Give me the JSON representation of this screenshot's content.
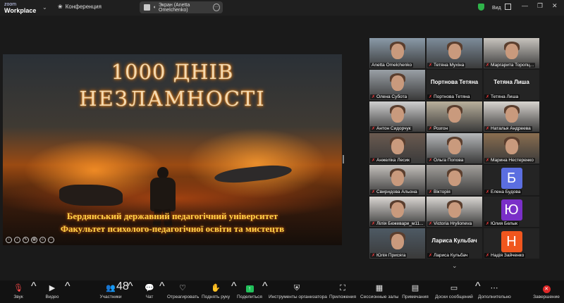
{
  "app": {
    "logo_line1": "zoom",
    "logo_line2": "Workplace"
  },
  "meeting": {
    "title": "Конференция"
  },
  "screen_share_pill": {
    "label": "Экран (Anetta Omelchenko)"
  },
  "top_right": {
    "view_label": "Вид"
  },
  "slide": {
    "title_line1": "1000 ДНІВ",
    "title_line2": "НЕЗЛАМНОСТІ",
    "bottom_line1": "Бердянський державний педагогічний університет",
    "bottom_line2": "Факультет психолого-педагогічної освіти та мистецтв"
  },
  "participants": [
    {
      "name": "Anetta Omelchenko",
      "muted": false,
      "speaking": true,
      "type": "video",
      "bg": "#8a9aa8"
    },
    {
      "name": "Тетяна Мухіна",
      "muted": true,
      "type": "video",
      "bg": "#7d8c9a"
    },
    {
      "name": "Маргарита Торопц...",
      "muted": true,
      "type": "video",
      "bg": "#c8c4be"
    },
    {
      "name": "Олена Субота",
      "muted": true,
      "type": "video",
      "bg": "#9aa0a6"
    },
    {
      "name": "Портнова Тетяна",
      "display": "Портнова Тетяна",
      "muted": true,
      "type": "name"
    },
    {
      "name": "Тетяна Лиша",
      "display": "Тетяна Лиша",
      "muted": true,
      "type": "name"
    },
    {
      "name": "Антон Сидорчук",
      "muted": true,
      "type": "video",
      "bg": "#cfcfcf"
    },
    {
      "name": "Розгон",
      "muted": true,
      "type": "video",
      "bg": "#b9b09c"
    },
    {
      "name": "Наталья Андреева",
      "muted": true,
      "type": "video",
      "bg": "#d8d4cf"
    },
    {
      "name": "Анжеліка Лесик",
      "muted": true,
      "type": "video",
      "bg": "#6a5a50"
    },
    {
      "name": "Ольга Попова",
      "muted": true,
      "type": "video",
      "bg": "#b6b8ba"
    },
    {
      "name": "Марина Нестеренко",
      "muted": true,
      "type": "video",
      "bg": "#8a6e50"
    },
    {
      "name": "Свиридова Альона",
      "muted": true,
      "type": "video",
      "bg": "#c4c0bc"
    },
    {
      "name": "Вікторія",
      "muted": true,
      "type": "video",
      "bg": "#a3a09c"
    },
    {
      "name": "Елена Будова",
      "muted": true,
      "type": "avatar",
      "letter": "Б",
      "color": "#5b6ee0"
    },
    {
      "name": "Лілія Бежевари_м11...",
      "muted": true,
      "type": "video",
      "bg": "#dad6d2"
    },
    {
      "name": "Victoria Hrylіoneva",
      "muted": true,
      "type": "video",
      "bg": "#d9d6d2"
    },
    {
      "name": "Юлия Белык",
      "muted": true,
      "type": "avatar",
      "letter": "Ю",
      "color": "#7a2fc8"
    },
    {
      "name": "Юлія Присяга",
      "muted": true,
      "type": "video",
      "bg": "#4e5a64"
    },
    {
      "name": "Лариса Кульбач",
      "display": "Лариса Кульбач",
      "muted": true,
      "type": "name"
    },
    {
      "name": "Надія Зайченко",
      "muted": true,
      "type": "avatar",
      "letter": "Н",
      "color": "#f0561e"
    }
  ],
  "toolbar": {
    "mute": "Звук",
    "video": "Видео",
    "participants": "Участники",
    "participants_count": "48",
    "chat": "Чат",
    "react": "Отреагировать",
    "raise_hand": "Поднять руку",
    "share": "Поделиться",
    "host_tools": "Инструменты организатора",
    "apps": "Приложения",
    "breakout": "Сессионные залы",
    "notes": "Примечания",
    "whiteboards": "Доски сообщений",
    "more": "Дополнительно",
    "end": "Завершение"
  },
  "colors": {
    "speaking_border": "#2ecc40",
    "share_button": "#21c05a",
    "end_button": "#e02828",
    "muted_icon": "#ff3b3b"
  }
}
